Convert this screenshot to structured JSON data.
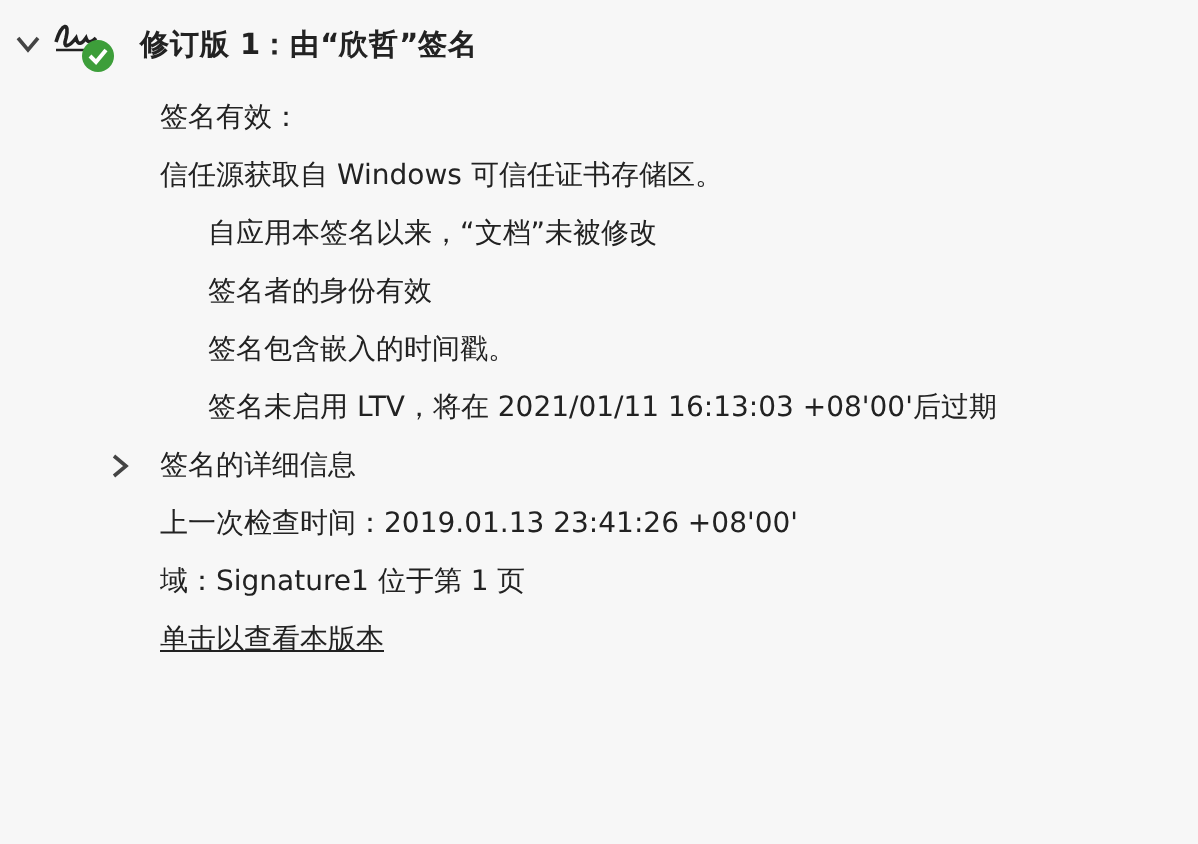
{
  "signature": {
    "title": "修订版 1：由“欣哲”签名",
    "expanded": true,
    "valid": true,
    "items": [
      {
        "kind": "line",
        "text": "签名有效："
      },
      {
        "kind": "line",
        "text": "信任源获取自 Windows 可信任证书存储区。"
      },
      {
        "kind": "indented",
        "text": "自应用本签名以来，“文档”未被修改"
      },
      {
        "kind": "indented",
        "text": "签名者的身份有效"
      },
      {
        "kind": "indented",
        "text": "签名包含嵌入的时间戳。"
      },
      {
        "kind": "indented",
        "text": "签名未启用 LTV，将在 2021/01/11 16:13:03 +08'00'后过期"
      },
      {
        "kind": "details",
        "text": "签名的详细信息",
        "expanded": false
      },
      {
        "kind": "line",
        "text": "上一次检查时间：2019.01.13 23:41:26 +08'00'"
      },
      {
        "kind": "line",
        "text": "域：Signature1 位于第 1 页"
      },
      {
        "kind": "link",
        "text": "单击以查看本版本"
      }
    ]
  }
}
